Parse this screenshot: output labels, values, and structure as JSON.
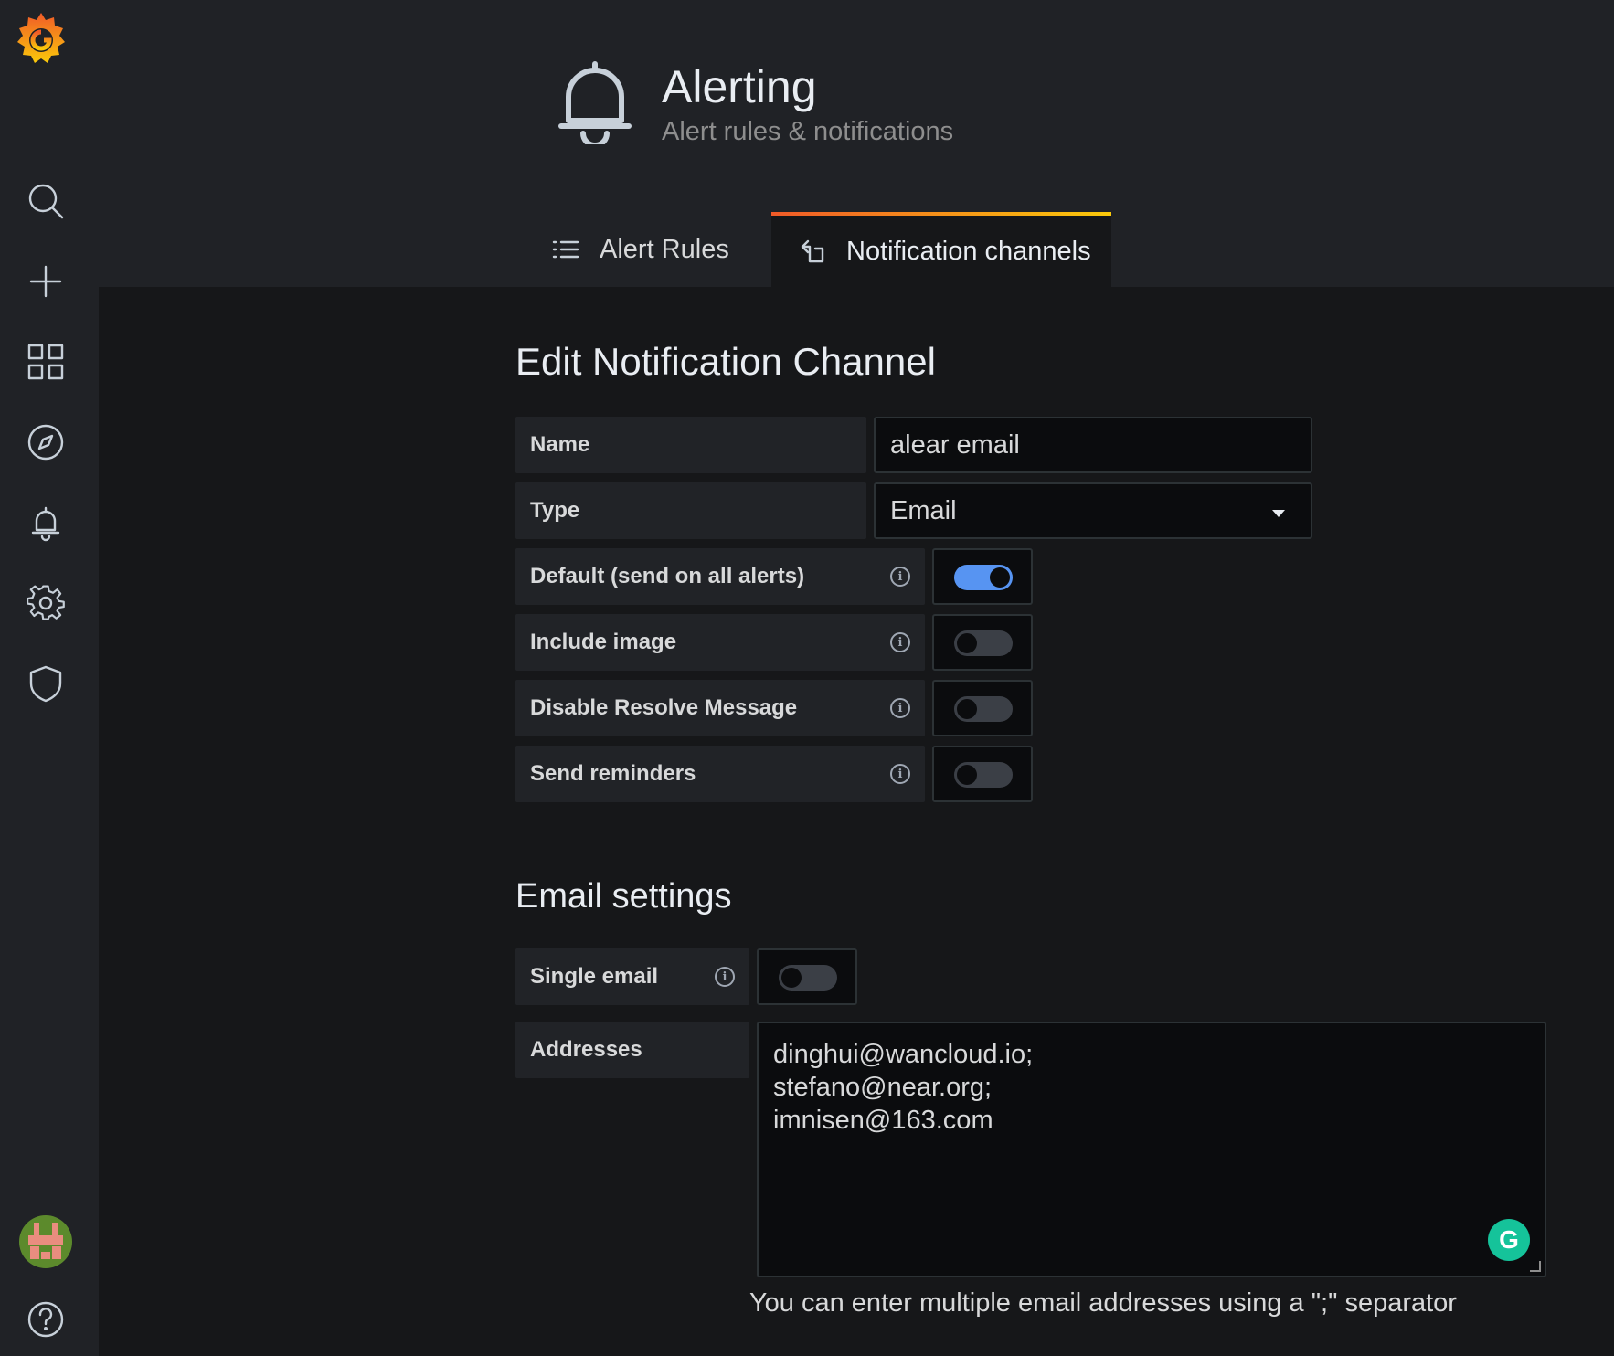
{
  "header": {
    "title": "Alerting",
    "subtitle": "Alert rules & notifications"
  },
  "tabs": [
    {
      "label": "Alert Rules",
      "active": false
    },
    {
      "label": "Notification channels",
      "active": true
    }
  ],
  "sidebar": {
    "items": [
      "search-icon",
      "plus-icon",
      "dashboards-icon",
      "explore-icon",
      "bell-icon",
      "gear-icon",
      "shield-icon",
      "help-icon"
    ]
  },
  "form": {
    "title": "Edit Notification Channel",
    "name_label": "Name",
    "name_value": "alear email",
    "type_label": "Type",
    "type_value": "Email",
    "toggles": [
      {
        "label": "Default (send on all alerts)",
        "on": true
      },
      {
        "label": "Include image",
        "on": false
      },
      {
        "label": "Disable Resolve Message",
        "on": false
      },
      {
        "label": "Send reminders",
        "on": false
      }
    ]
  },
  "email_settings": {
    "title": "Email settings",
    "single_email_label": "Single email",
    "single_email_on": false,
    "addresses_label": "Addresses",
    "addresses": [
      "dinghui@wancloud.io;",
      "stefano@near.org;",
      "imnisen@163.com"
    ],
    "helper": "You can enter multiple email addresses using a \";\" separator"
  },
  "colors": {
    "accent": "#5794f2",
    "tab_gradient_start": "#f05a28",
    "tab_gradient_end": "#fbca0a",
    "grammarly": "#15c39a"
  }
}
